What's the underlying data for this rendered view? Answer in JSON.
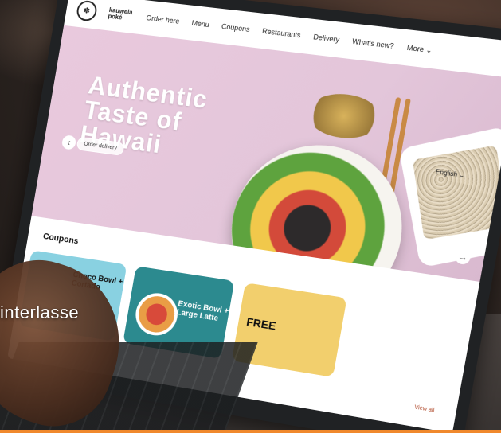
{
  "caption": "interlasse",
  "site": {
    "brand": "kauwela poké",
    "nav_items": [
      "Order here",
      "Menu",
      "Coupons",
      "Restaurants",
      "Delivery",
      "What's new?",
      "More ⌄"
    ],
    "language": "English ⌄"
  },
  "hero": {
    "title": "Authentic Taste of Hawaii",
    "cta": "Order delivery"
  },
  "coupons": {
    "title": "Coupons",
    "cards": [
      {
        "label": "Choco Bowl + Cortado",
        "color": "#89d1e1"
      },
      {
        "label": "Exotic Bowl + Large Latte",
        "color": "#2c8a8f"
      },
      {
        "label": "FREE",
        "color": "#f2cf6d"
      }
    ],
    "view_all": "View all"
  },
  "colors": {
    "accent_bar": "#f0892d",
    "hero_bg": "#e9c9dd"
  }
}
